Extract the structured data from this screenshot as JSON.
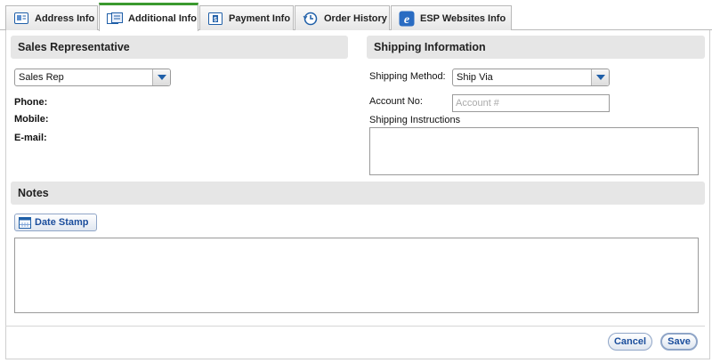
{
  "tabs": [
    {
      "label": "Address Info",
      "icon": "address-card-icon",
      "active": false
    },
    {
      "label": "Additional Info",
      "icon": "additional-info-icon",
      "active": true
    },
    {
      "label": "Payment Info",
      "icon": "payment-icon",
      "active": false
    },
    {
      "label": "Order History",
      "icon": "order-history-icon",
      "active": false
    },
    {
      "label": "ESP Websites Info",
      "icon": "esp-websites-icon",
      "active": false
    }
  ],
  "sales_rep": {
    "title": "Sales Representative",
    "select_value": "Sales Rep",
    "phone_label": "Phone:",
    "mobile_label": "Mobile:",
    "email_label": "E-mail:"
  },
  "shipping": {
    "title": "Shipping Information",
    "method_label": "Shipping Method:",
    "method_value": "Ship Via",
    "account_label": "Account No:",
    "account_placeholder": "Account #",
    "instructions_label": "Shipping Instructions"
  },
  "notes": {
    "title": "Notes",
    "date_stamp_label": "Date Stamp"
  },
  "footer": {
    "cancel_label": "Cancel",
    "save_label": "Save"
  },
  "colors": {
    "active_tab_accent": "#3b9a2e",
    "button_text": "#1a4d9c"
  }
}
